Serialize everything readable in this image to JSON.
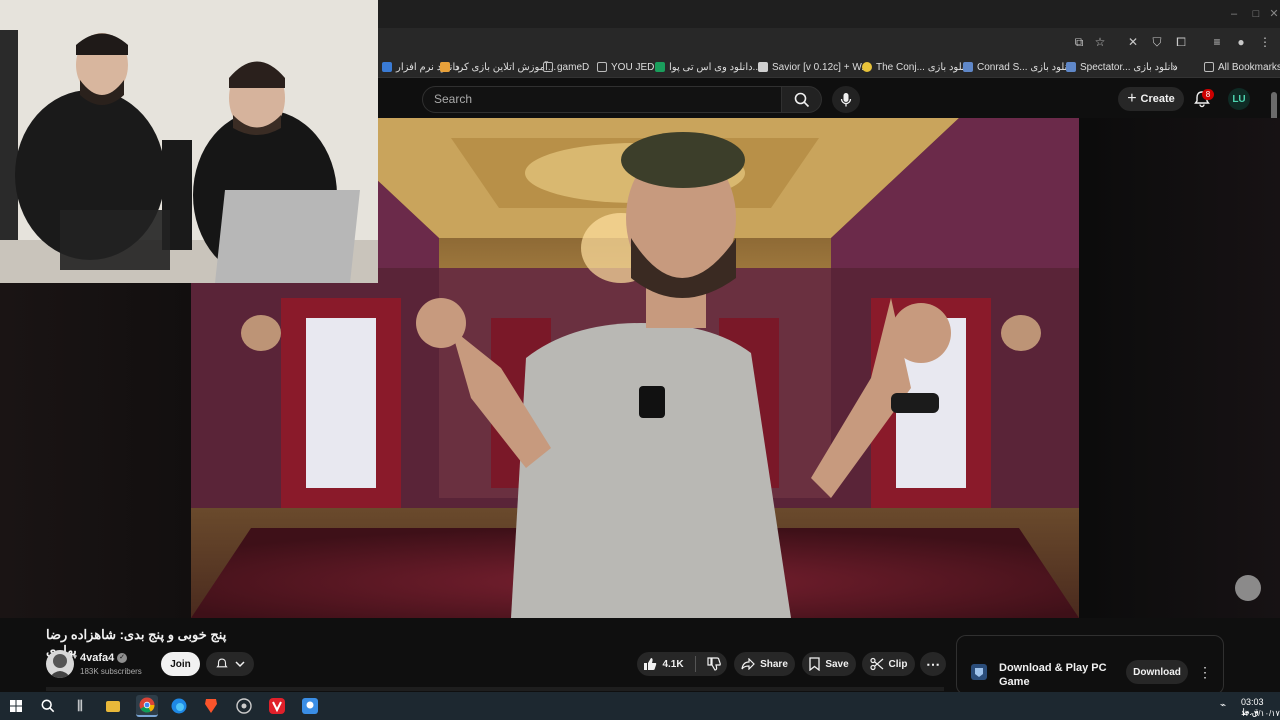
{
  "browser": {
    "bookmarks": [
      {
        "label": "دانلود نرم افزار",
        "color": "#3a7bd5"
      },
      {
        "label": "آموزش اتلاین بازی کرد...",
        "color": "#e8a13a"
      },
      {
        "label": "gameD",
        "color": "#9aa0a6"
      },
      {
        "label": "YOU JED",
        "color": "#9aa0a6"
      },
      {
        "label": "دانلود وی اس تی پوا...",
        "color": "#1a9e5c"
      },
      {
        "label": "Savior [v 0.12c] + W...",
        "color": "#d0d0d0"
      },
      {
        "label": "The Conj... دانلود بازی",
        "color": "#e8c33a"
      },
      {
        "label": "Conrad S... دانلود بازی",
        "color": "#5f87c8"
      },
      {
        "label": "Spectator... دانلود بازی",
        "color": "#5f87c8"
      }
    ],
    "all_bookmarks": "All Bookmarks"
  },
  "header": {
    "search_placeholder": "Search",
    "create_label": "Create",
    "notification_count": "8",
    "avatar_initials": "LU"
  },
  "video": {
    "title": "پنج خوبی و پنج بدی: شاهزاده رضا پهلوی",
    "channel": "4vafa4",
    "subscribers": "183K subscribers",
    "join_label": "Join",
    "likes": "4.1K",
    "share_label": "Share",
    "save_label": "Save",
    "clip_label": "Clip"
  },
  "ad": {
    "title": "Download & Play PC Game",
    "button": "Download"
  },
  "taskbar": {
    "time": "03:03 ق.ظ",
    "date": "۱۴۰۳/۱۰/۱۷"
  },
  "colors": {
    "accent": "#cc0000",
    "background": "#0f0f0f",
    "pill": "#272727"
  }
}
